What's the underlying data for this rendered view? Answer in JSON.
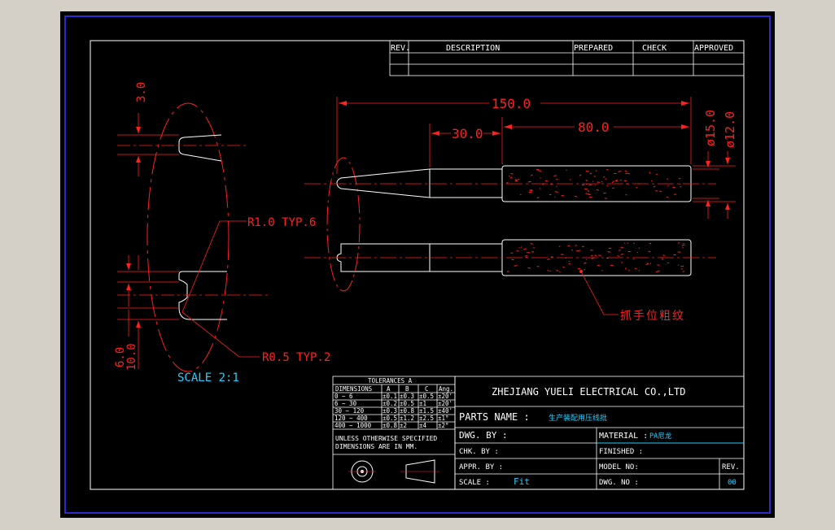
{
  "colors": {
    "background": "#000000",
    "frame": "#2a2ad0",
    "line": "#ffffff",
    "dimension": "#ff2020",
    "accent": "#20d0ff",
    "desktop": "#d4d0c8"
  },
  "revision_table": {
    "headers": [
      "REV.",
      "DESCRIPTION",
      "PREPARED",
      "CHECK",
      "APPROVED"
    ]
  },
  "dimensions": {
    "overall_length": "150.0",
    "handle_length": "80.0",
    "tip_offset": "30.0",
    "diameter_outer": "ø15.0",
    "diameter_inner": "ø12.0",
    "slot_width_top": "3.0",
    "slot_bottom_a": "6.0",
    "slot_bottom_b": "10.0",
    "radius_1": "R1.0  TYP.6",
    "radius_2": "R0.5  TYP.2",
    "detail_scale": "SCALE 2:1",
    "knurl_note": "抓手位粗纹"
  },
  "tolerances": {
    "title": "TOLERANCES  A",
    "headers": [
      "DIMENSIONS",
      "A",
      "B",
      "C",
      "Ang."
    ],
    "rows": [
      [
        "0 ~ 6",
        "±0.1",
        "±0.3",
        "±0.5",
        "±20'"
      ],
      [
        "6 ~ 30",
        "±0.2",
        "±0.5",
        "±1",
        "±20'"
      ],
      [
        "30 ~ 120",
        "±0.3",
        "±0.8",
        "±1.5",
        "±40'"
      ],
      [
        "120 ~ 400",
        "±0.5",
        "±1.2",
        "±2.5",
        "±1°"
      ],
      [
        "400 ~ 1000",
        "±0.8",
        "±2",
        "±4",
        "±2°"
      ]
    ],
    "note_1": "UNLESS OTHERWISE SPECIFIED",
    "note_2": "DIMENSIONS ARE IN MM."
  },
  "title_block": {
    "company": "ZHEJIANG YUELI ELECTRICAL CO.,LTD",
    "parts_name_label": "PARTS NAME :",
    "parts_name_value": "生产装配用压线批",
    "dwg_by_label": "DWG. BY :",
    "material_label": "MATERIAL :",
    "material_value": "PA尼龙",
    "chk_by_label": "CHK. BY :",
    "finished_label": "FINISHED :",
    "appr_by_label": "APPR. BY :",
    "model_no_label": "MODEL NO:",
    "rev_label": "REV.",
    "scale_label": "SCALE :",
    "scale_value": "Fit",
    "dwg_no_label": "DWG. NO :",
    "rev_value": "00"
  }
}
